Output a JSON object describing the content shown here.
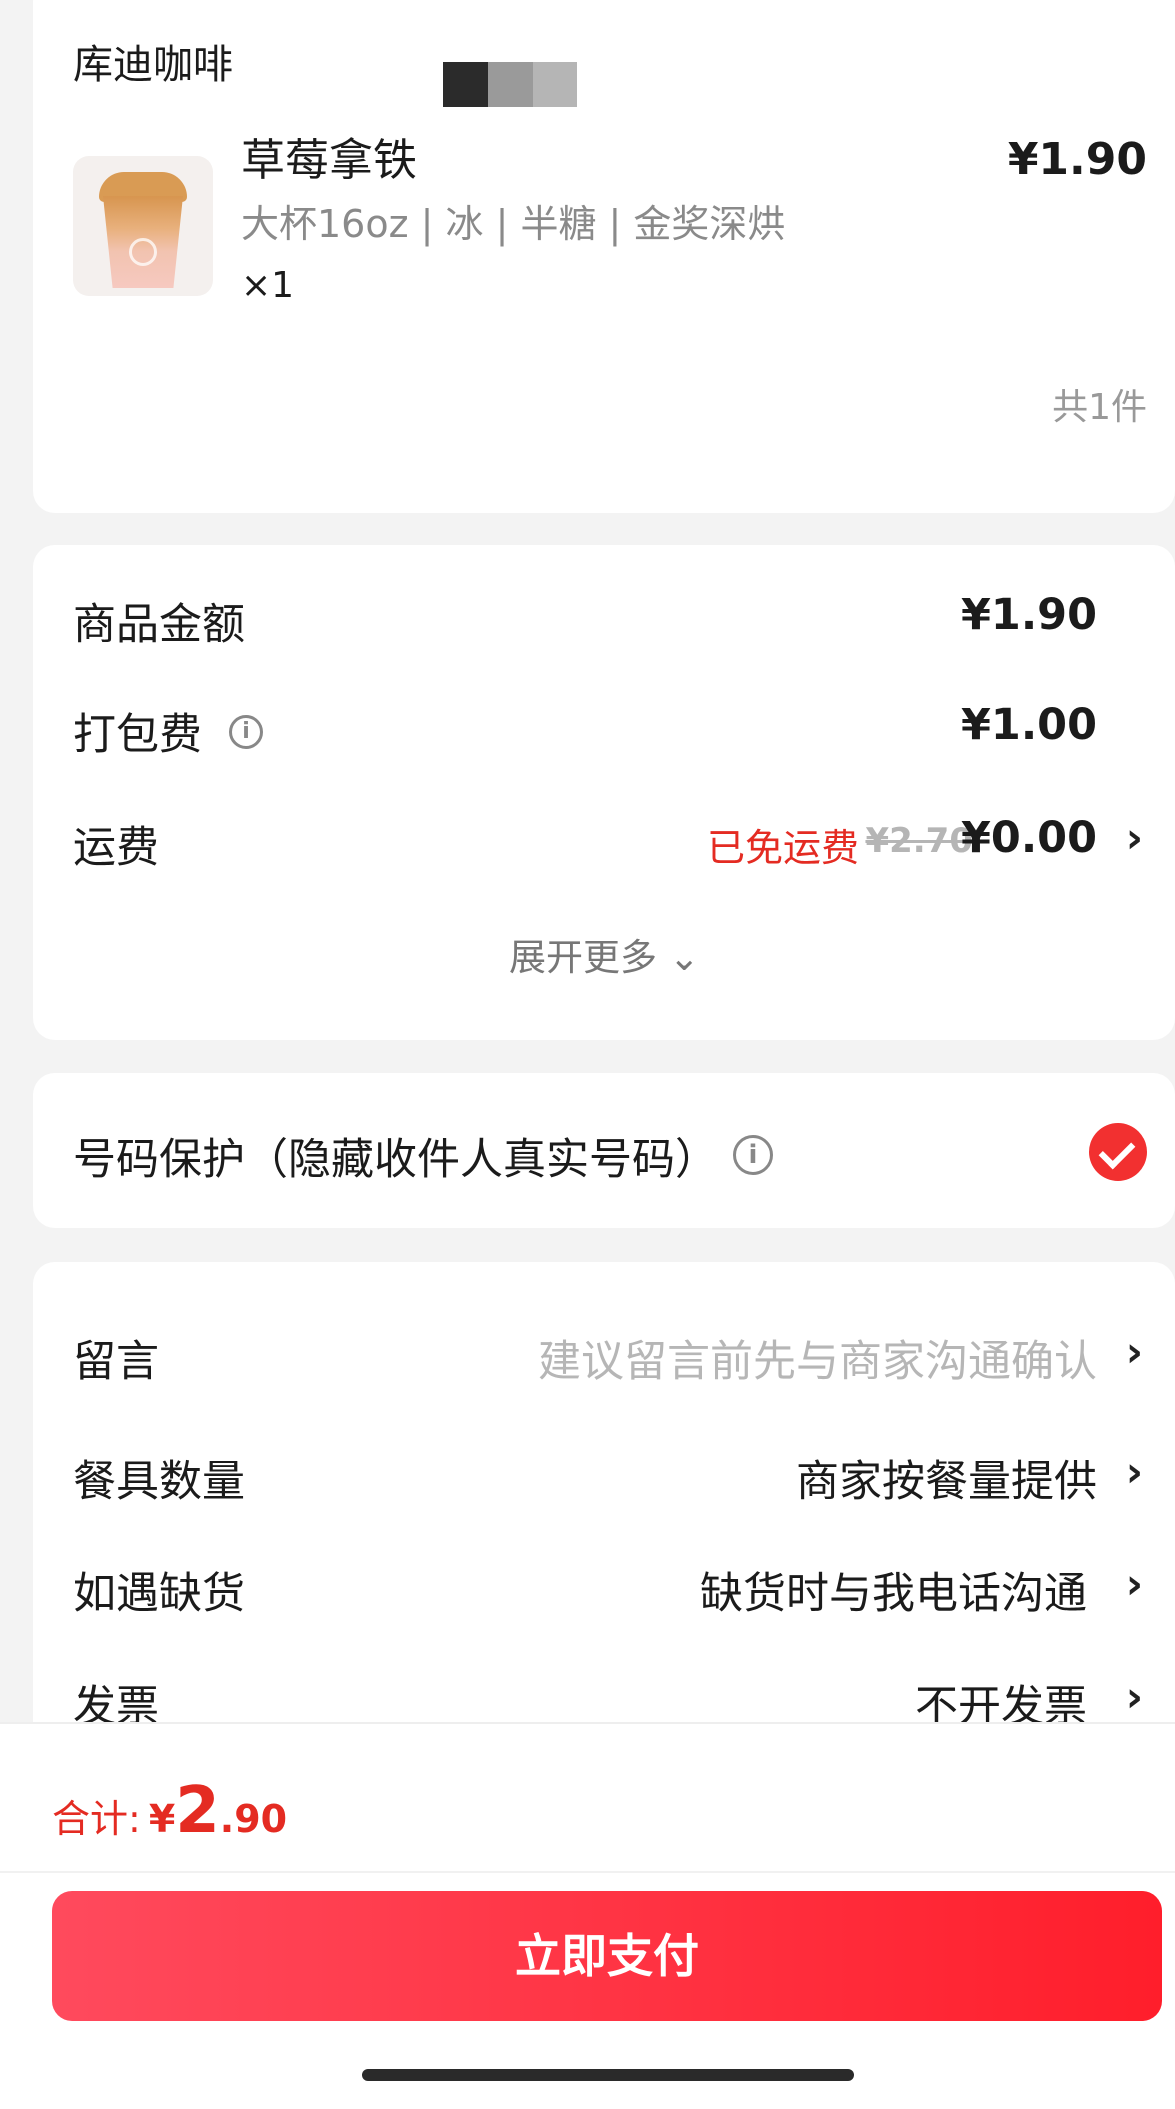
{
  "order": {
    "shop_name": "库迪咖啡",
    "product_name": "草莓拿铁",
    "product_spec": "大杯16oz | 冰 | 半糖 | 金奖深烘",
    "quantity": "×1",
    "price": "¥1.90",
    "item_count": "共1件"
  },
  "fees": {
    "goods_label": "商品金额",
    "goods_value": "¥1.90",
    "pack_label": "打包费",
    "pack_value": "¥1.00",
    "ship_label": "运费",
    "ship_free": "已免运费",
    "ship_original": "¥2.70",
    "ship_value": "¥0.00",
    "expand_label": "展开更多 ⌄"
  },
  "phone": {
    "label": "号码保护（隐藏收件人真实号码）",
    "checked": true
  },
  "options": {
    "note_label": "留言",
    "note_placeholder": "建议留言前先与商家沟通确认",
    "tableware_label": "餐具数量",
    "tableware_value": "商家按餐量提供",
    "stockout_label": "如遇缺货",
    "stockout_value": "缺货时与我电话沟通",
    "invoice_label": "发票",
    "invoice_value": "不开发票"
  },
  "footer": {
    "total_label": "合计:",
    "total_currency": "¥",
    "total_integer": "2",
    "total_decimal": ".90",
    "pay_label": "立即支付"
  },
  "icons": {
    "info": "info-icon",
    "chevron": "chevron-right-icon",
    "check": "check-icon"
  },
  "colors": {
    "accent_red": "#e42b22",
    "pay_gradient_start": "#ff4a5d",
    "pay_gradient_end": "#ff1e2b"
  }
}
